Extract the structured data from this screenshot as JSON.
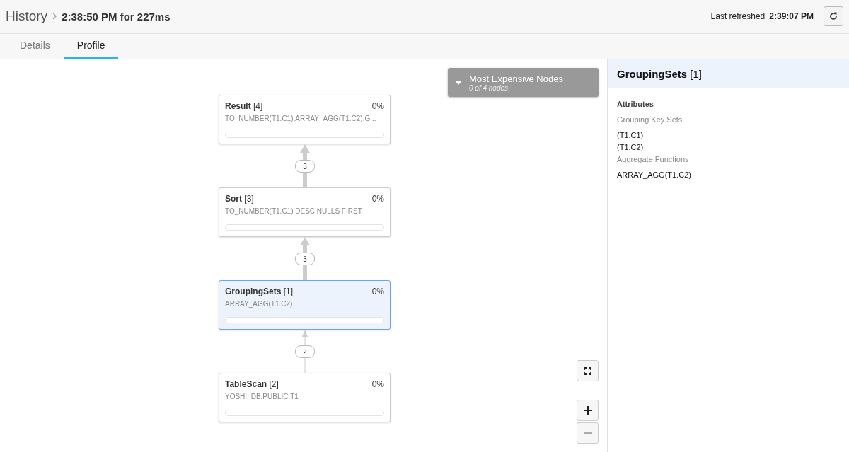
{
  "header": {
    "breadcrumb": "History",
    "title": "2:38:50 PM for 227ms",
    "refreshed_label": "Last refreshed",
    "refreshed_time": "2:39:07 PM"
  },
  "tabs": [
    {
      "label": "Details",
      "selected": false
    },
    {
      "label": "Profile",
      "selected": true
    }
  ],
  "expensive_nodes": {
    "title": "Most Expensive Nodes",
    "subtitle": "0 of 4 nodes"
  },
  "nodes": [
    {
      "name": "Result",
      "id": "[4]",
      "percent": "0%",
      "detail": "TO_NUMBER(T1.C1),ARRAY_AGG(T1.C2),G...",
      "selected": false
    },
    {
      "name": "Sort",
      "id": "[3]",
      "percent": "0%",
      "detail": "TO_NUMBER(T1.C1) DESC NULLS FIRST",
      "selected": false
    },
    {
      "name": "GroupingSets",
      "id": "[1]",
      "percent": "0%",
      "detail": "ARRAY_AGG(T1.C2)",
      "selected": true
    },
    {
      "name": "TableScan",
      "id": "[2]",
      "percent": "0%",
      "detail": "YOSHI_DB.PUBLIC.T1",
      "selected": false
    }
  ],
  "edges": [
    {
      "rows": "3",
      "kind": "thick"
    },
    {
      "rows": "3",
      "kind": "thick"
    },
    {
      "rows": "2",
      "kind": "thin"
    }
  ],
  "panel": {
    "title": "GroupingSets",
    "id": "[1]",
    "section": "Attributes",
    "attributes": [
      {
        "label": "Grouping Key Sets",
        "values": [
          "(T1.C1)",
          "(T1.C2)"
        ]
      },
      {
        "label": "Aggregate Functions",
        "values": [
          "ARRAY_AGG(T1.C2)"
        ]
      }
    ]
  }
}
